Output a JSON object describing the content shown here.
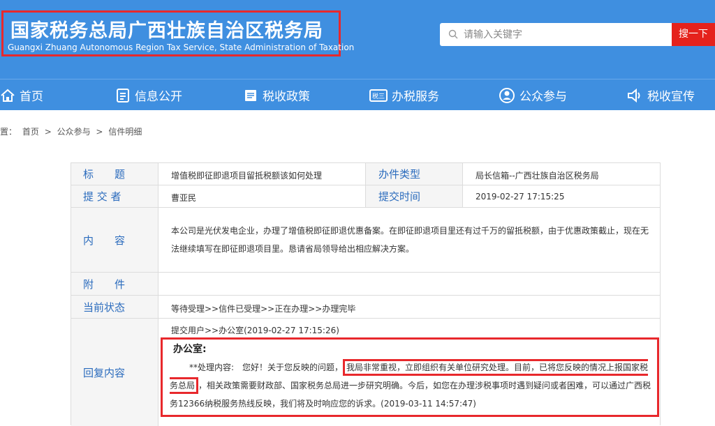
{
  "header": {
    "title_cn": "国家税务总局广西壮族自治区税务局",
    "title_en": "Guangxi Zhuang Autonomous Region Tax Service, State Administration of Taxation"
  },
  "search": {
    "placeholder": "请输入关键字",
    "button_label": "搜一下"
  },
  "nav": {
    "items": [
      {
        "label": "首页",
        "icon": "home-icon"
      },
      {
        "label": "信息公开",
        "icon": "document-list-icon"
      },
      {
        "label": "税收政策",
        "icon": "book-icon"
      },
      {
        "label": "办税服务",
        "icon": "tax-badge-icon"
      },
      {
        "label": "公众参与",
        "icon": "user-circle-icon"
      },
      {
        "label": "税收宣传",
        "icon": "speaker-icon"
      }
    ]
  },
  "breadcrumb": {
    "prefix": "位置：",
    "items": [
      "首页",
      ">",
      "公众参与",
      ">",
      "信件明细"
    ]
  },
  "letter": {
    "title_label": "标　　题",
    "title_value": "增值税即征即退项目留抵税额该如何处理",
    "type_label": "办件类型",
    "type_value": "局长信箱--广西壮族自治区税务局",
    "submitter_label": "提 交 者",
    "submitter_value": "曹亚民",
    "time_label": "提交时间",
    "time_value": "2019-02-27 17:15:25",
    "content_label": "内　　容",
    "content_value": "本公司是光伏发电企业，办理了增值税即征即退优惠备案。在即征即退项目里还有过千万的留抵税额，由于优惠政策截止，现在无法继续填写在即征即退项目里。恳请省局领导给出相应解决方案。",
    "attachment_label": "附　　件",
    "attachment_value": "",
    "status_label": "当前状态",
    "status_value": "等待受理>>信件已受理>>正在办理>>办理完毕",
    "reply_label": "回复内容",
    "reply_meta": "提交用户>>办公室(2019-02-27 17:15:26)",
    "reply_dept": "办公室:",
    "reply_part1": "**处理内容:　您好！关于您反映的问题，",
    "reply_highlight": "我局非常重视，立即组织有关单位研究处理。目前，已将您反映的情况上报国家税务总局",
    "reply_part2": "，相关政策需要财政部、国家税务总局进一步研究明确。今后，如您在办理涉税事项时遇到疑问或者困难，可以通过广西税务12366纳税服务热线反映，我们将及时响应您的诉求。(2019-03-11 14:57:47)"
  },
  "colors": {
    "header_bg": "#3f8fe0",
    "highlight_border": "#e8282c",
    "search_button": "#e5221c",
    "label_text": "#2a6bbd"
  }
}
